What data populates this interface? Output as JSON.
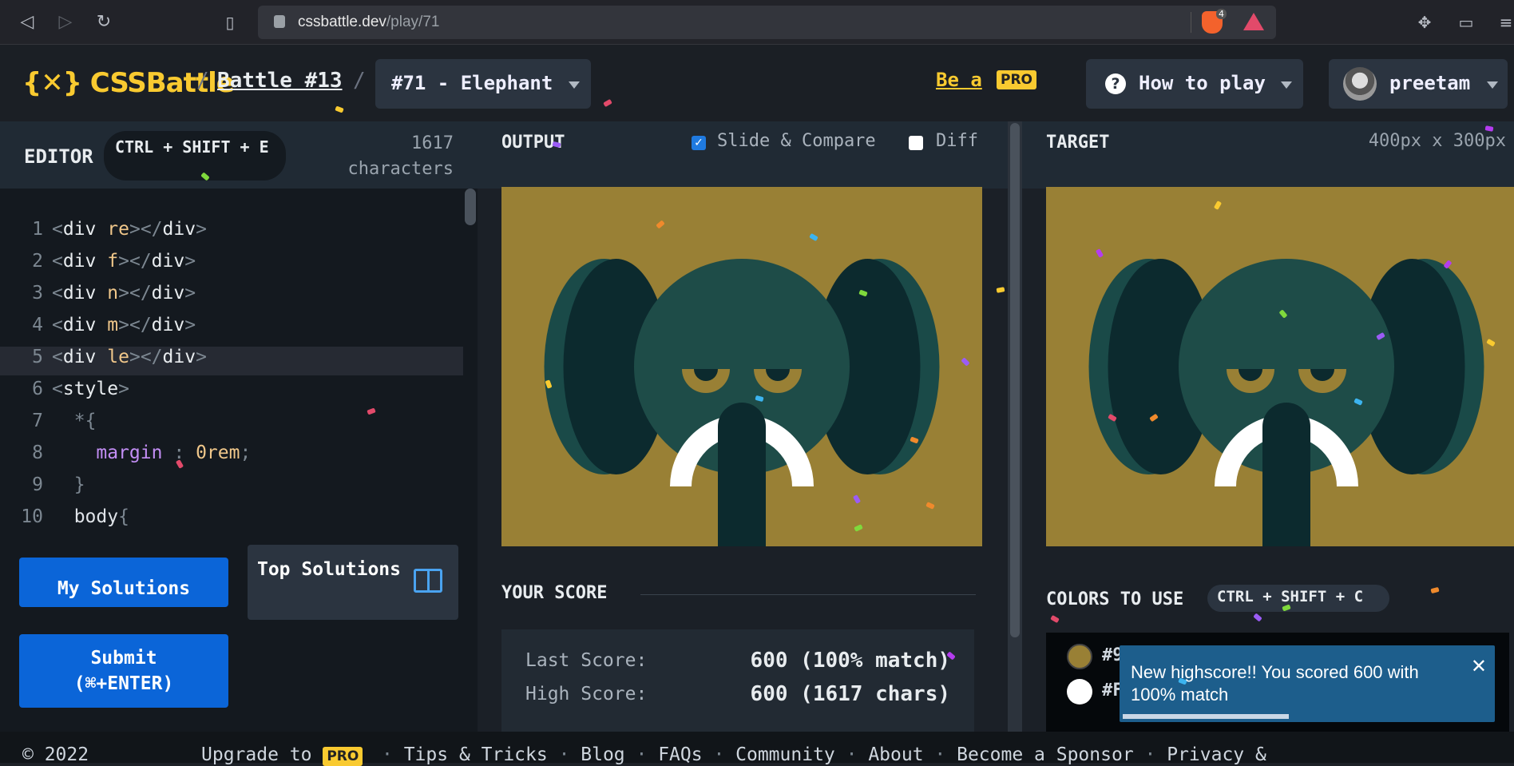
{
  "browser": {
    "url_host": "cssbattle.dev",
    "url_path": "/play/71",
    "extension_count": "4"
  },
  "header": {
    "logo": "{✕} CSSBattle",
    "sep": "/",
    "battle": "Battle #13",
    "target": "#71 - Elephant",
    "be_a": "Be a",
    "pro": "PRO",
    "how_to_play": "How to play",
    "user": "preetam"
  },
  "editor": {
    "title": "EDITOR",
    "shortcut": "CTRL + SHIFT + E",
    "char_count": "1617",
    "char_label": "characters",
    "lines": [
      {
        "n": "1",
        "code": "<div re></div>"
      },
      {
        "n": "2",
        "code": "<div f></div>"
      },
      {
        "n": "3",
        "code": "<div n></div>"
      },
      {
        "n": "4",
        "code": "<div m></div>"
      },
      {
        "n": "5",
        "code": "<div le></div>"
      },
      {
        "n": "6",
        "code": "<style>"
      },
      {
        "n": "7",
        "code": "  *{"
      },
      {
        "n": "8",
        "code": "    margin : 0rem;"
      },
      {
        "n": "9",
        "code": "  }"
      },
      {
        "n": "10",
        "code": "  body{"
      }
    ],
    "my_solutions": "My Solutions",
    "top_solutions": "Top Solutions",
    "submit": "Submit",
    "submit_shortcut": "(⌘+ENTER)"
  },
  "output": {
    "title": "OUTPUT",
    "slide_compare": "Slide & Compare",
    "slide_checked": true,
    "diff": "Diff",
    "diff_checked": false,
    "score_title": "YOUR SCORE",
    "last_score_label": "Last Score:",
    "last_score": "600 (100% match)",
    "high_score_label": "High Score:",
    "high_score": "600 (1617 chars)"
  },
  "target": {
    "title": "TARGET",
    "dimensions": "400px x 300px",
    "colors_title": "COLORS TO USE",
    "colors_shortcut": "CTRL + SHIFT + C",
    "colors": [
      {
        "hex": "#998035",
        "label": "#9"
      },
      {
        "hex": "#FFFFFF",
        "label": "#F"
      }
    ]
  },
  "toast": {
    "message": "New highscore!! You scored 600 with 100% match",
    "close": "✕",
    "progress": 0.45
  },
  "palette": {
    "bg": "#998035",
    "dark": "#0c2a2e",
    "mid": "#1a4a48",
    "head": "#1e4c48",
    "white": "#ffffff"
  },
  "footer": {
    "copyright": "© 2022",
    "upgrade": "Upgrade to",
    "pro": "PRO",
    "dot": "·",
    "links": [
      "Tips & Tricks",
      "Blog",
      "FAQs",
      "Community",
      "About",
      "Become a Sponsor",
      "Privacy &"
    ]
  }
}
